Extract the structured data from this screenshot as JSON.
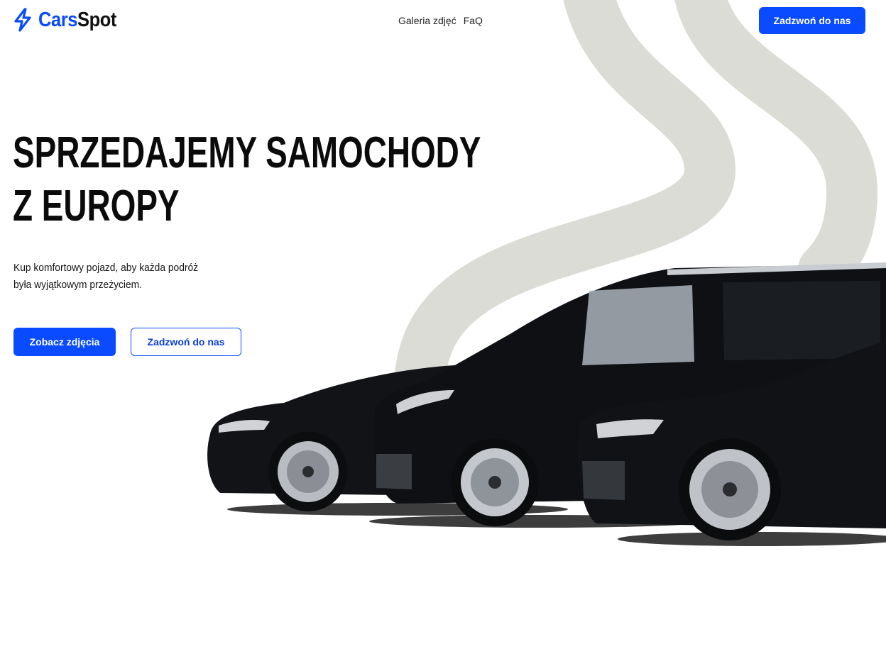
{
  "brand": {
    "name_part1": "Cars",
    "name_part2": "Spot",
    "primary_color": "#0a4bff",
    "swirl_color": "#dcdcd6",
    "icon": "lightning-bolt-icon"
  },
  "nav": {
    "items": [
      {
        "label": "Galeria zdjęć"
      },
      {
        "label": "FaQ"
      }
    ]
  },
  "header": {
    "cta_label": "Zadzwoń do nas"
  },
  "hero": {
    "title_line1": "SPRZEDAJEMY SAMOCHODY",
    "title_line2": "Z EUROPY",
    "subtitle_line1": "Kup komfortowy pojazd, aby każda podróż",
    "subtitle_line2": "była wyjątkowym przeżyciem.",
    "primary_cta": "Zobacz zdjęcia",
    "secondary_cta": "Zadzwoń do nas",
    "image": "three-black-cars-photo"
  }
}
